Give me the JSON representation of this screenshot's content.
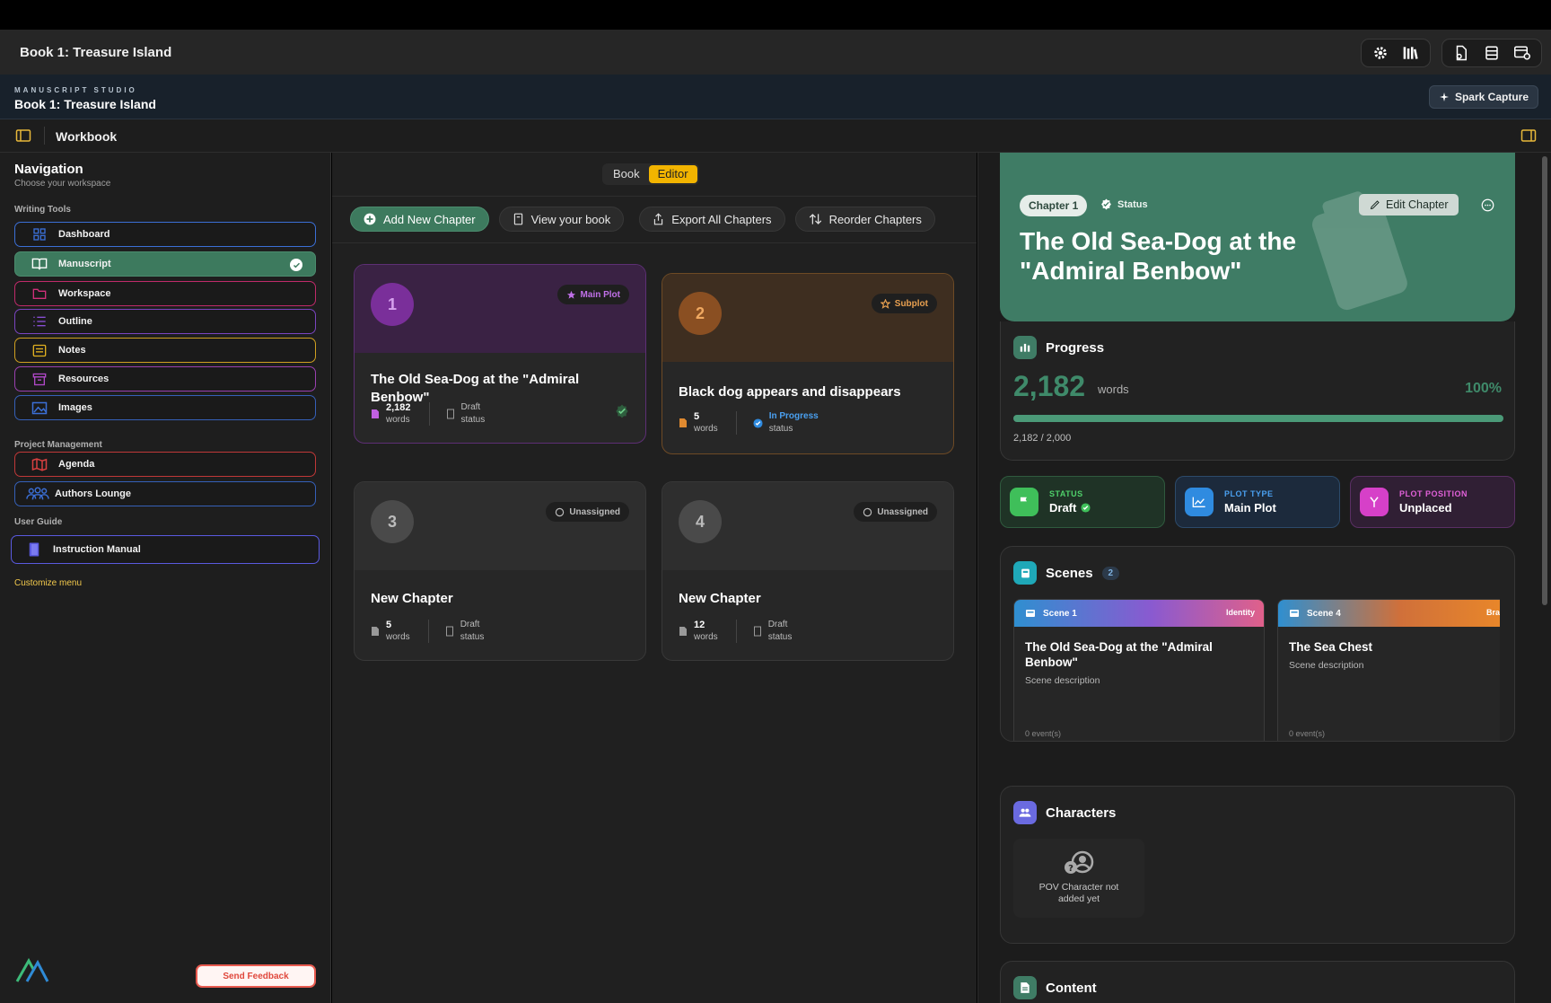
{
  "window": {
    "title": "Book 1: Treasure Island"
  },
  "header": {
    "kicker": "MANUSCRIPT STUDIO",
    "book_title": "Book 1: Treasure Island",
    "spark_label": "Spark Capture"
  },
  "workbar": {
    "label": "Workbook"
  },
  "sidebar": {
    "title": "Navigation",
    "subtitle": "Choose your workspace",
    "sections": {
      "writing": "Writing Tools",
      "project": "Project Management",
      "guide": "User Guide"
    },
    "items": [
      {
        "label": "Dashboard",
        "icon": "grid-icon",
        "color": "#3b6fd6"
      },
      {
        "label": "Manuscript",
        "icon": "book-open-icon",
        "color": "#4b8c6e",
        "active": true
      },
      {
        "label": "Workspace",
        "icon": "folder-icon",
        "color": "#d1307a"
      },
      {
        "label": "Outline",
        "icon": "list-icon",
        "color": "#8a4fd6"
      },
      {
        "label": "Notes",
        "icon": "note-icon",
        "color": "#e0b020"
      },
      {
        "label": "Resources",
        "icon": "archive-icon",
        "color": "#b048c8"
      },
      {
        "label": "Images",
        "icon": "image-icon",
        "color": "#3b6fd6"
      },
      {
        "label": "Agenda",
        "icon": "map-icon",
        "color": "#d84040"
      },
      {
        "label": "Authors Lounge",
        "icon": "users-icon",
        "color": "#3b6fd6"
      },
      {
        "label": "Instruction Manual",
        "icon": "manual-icon",
        "color": "#5a5ae0"
      }
    ],
    "customize": "Customize menu",
    "feedback": "Send Feedback"
  },
  "main": {
    "toggle": {
      "book": "Book",
      "editor": "Editor"
    },
    "actions": {
      "add": "Add New Chapter",
      "view": "View your book",
      "export": "Export All Chapters",
      "reorder": "Reorder Chapters"
    },
    "chapters": [
      {
        "number": "1",
        "badge": "Main Plot",
        "title": "The Old Sea-Dog at the \"Admiral Benbow\"",
        "words": "2,182",
        "words_label": "words",
        "status": "Draft",
        "status_label": "status",
        "accent": "#8c3bb0"
      },
      {
        "number": "2",
        "badge": "Subplot",
        "title": "Black dog appears and disappears",
        "words": "5",
        "words_label": "words",
        "status": "In Progress",
        "status_label": "status",
        "accent": "#d9772a"
      },
      {
        "number": "3",
        "badge": "Unassigned",
        "title": "New Chapter",
        "words": "5",
        "words_label": "words",
        "status": "Draft",
        "status_label": "status",
        "accent": "#555"
      },
      {
        "number": "4",
        "badge": "Unassigned",
        "title": "New Chapter",
        "words": "12",
        "words_label": "words",
        "status": "Draft",
        "status_label": "status",
        "accent": "#555"
      }
    ]
  },
  "detail": {
    "chip": "Chapter 1",
    "status_label": "Status",
    "edit": "Edit Chapter",
    "title": "The Old Sea-Dog at the \"Admiral Benbow\"",
    "progress": {
      "heading": "Progress",
      "words": "2,182",
      "unit": "words",
      "percent": "100%",
      "fraction": 1.0,
      "sub": "2,182 / 2,000"
    },
    "stats": [
      {
        "key": "STATUS",
        "value": "Draft",
        "color": "#4caf50"
      },
      {
        "key": "PLOT TYPE",
        "value": "Main Plot",
        "color": "#2f8be0"
      },
      {
        "key": "PLOT POSITION",
        "value": "Unplaced",
        "color": "#d640c8"
      }
    ],
    "scenes": {
      "heading": "Scenes",
      "count": "2",
      "items": [
        {
          "label": "Scene 1",
          "tag": "Identity",
          "title": "The Old Sea-Dog at the \"Admiral Benbow\"",
          "desc": "Scene description",
          "events": "0 event(s)"
        },
        {
          "label": "Scene 4",
          "tag": "Bra",
          "title": "The Sea Chest",
          "desc": "Scene description",
          "events": "0 event(s)"
        }
      ]
    },
    "characters": {
      "heading": "Characters",
      "pov": "POV Character not added yet"
    },
    "content": {
      "heading": "Content"
    }
  }
}
